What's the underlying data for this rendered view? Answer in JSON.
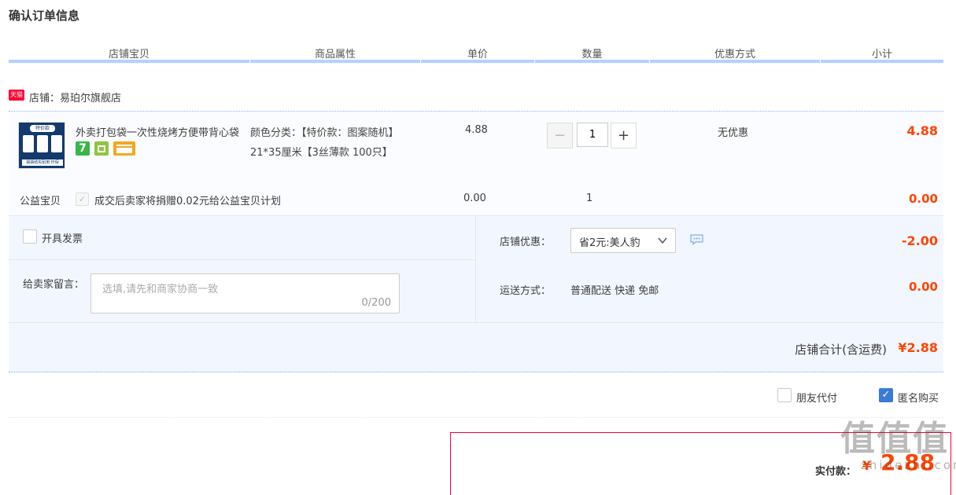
{
  "page_title": "确认订单信息",
  "headers": [
    "店铺宝贝",
    "商品属性",
    "单价",
    "数量",
    "优惠方式",
    "小计"
  ],
  "shop": {
    "badge": "天猫",
    "label": "店铺：易珀尔旗舰店"
  },
  "item": {
    "thumb_label": "特价款",
    "thumb_strip": "袋袋结实耐用 环保",
    "title": "外卖打包袋一次性烧烤方便带背心袋",
    "attr_color": "颜色分类：【特价款：图案随机】",
    "attr_size": "21*35厘米【3丝薄款 100只】",
    "price": "4.88",
    "quantity": "1",
    "discount": "无优惠",
    "subtotal": "4.88"
  },
  "charity": {
    "label": "公益宝贝",
    "text": "成交后卖家将捐赠0.02元给公益宝贝计划",
    "price": "0.00",
    "quantity": "1",
    "subtotal": "0.00"
  },
  "invoice_label": "开具发票",
  "message": {
    "label": "给卖家留言：",
    "placeholder": "选填,请先和商家协商一致",
    "counter": "0/200"
  },
  "shop_discount": {
    "label": "店铺优惠：",
    "selected": "省2元:美人豹",
    "amount": "-2.00"
  },
  "shipping": {
    "label": "运送方式：",
    "value": "普通配送 快递 免邮",
    "amount": "0.00"
  },
  "shop_total": {
    "label": "店铺合计(含运费)",
    "amount": "¥2.88"
  },
  "options": {
    "friend_pay": "朋友代付",
    "anonymous": "匿名购买"
  },
  "pay": {
    "label": "实付款：",
    "currency": "¥",
    "amount": "2.88"
  },
  "watermark": {
    "main": "值值值",
    "sub": "zhidezhi.com"
  },
  "colors": {
    "price_red": "#ff4400",
    "header_line": "#b2d1ff",
    "panel_bg": "#f2f7ff",
    "checkbox_blue": "#3a7bd5"
  }
}
